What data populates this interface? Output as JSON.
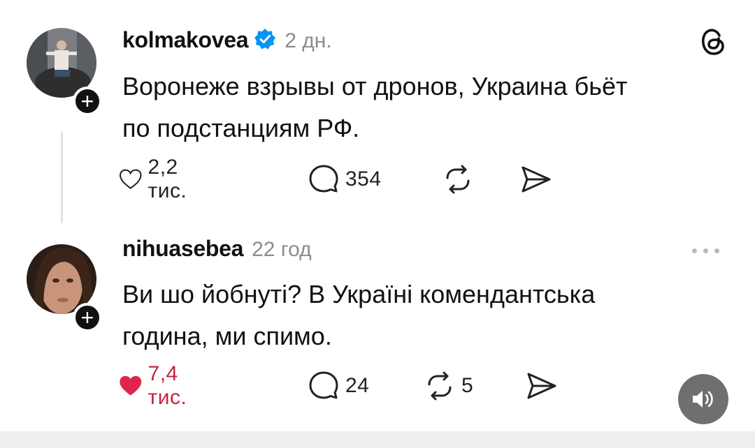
{
  "posts": [
    {
      "username": "kolmakovea",
      "verified": true,
      "time": "2 дн.",
      "text_lines": [
        "Воронеже взрывы от дронов, Украина бьёт",
        "по подстанциям РФ."
      ],
      "likes": "2,2 тис.",
      "liked": false,
      "comments": "354",
      "reposts": "",
      "avatar_icon": "avatar-photo-man-on-bull-statue"
    },
    {
      "username": "nihuasebea",
      "verified": false,
      "time": "22 год",
      "text_lines": [
        "Ви шо йобнуті? В Україні комендантська",
        "година, ми спимо."
      ],
      "likes": "7,4 тис.",
      "liked": true,
      "comments": "24",
      "reposts": "5",
      "avatar_icon": "avatar-photo-woman"
    }
  ],
  "icons": {
    "follow": "+",
    "like": "heart-icon",
    "comment": "comment-bubble-icon",
    "repost": "repost-icon",
    "share": "send-icon",
    "brand": "threads-logo-icon",
    "more": "more-dots-icon",
    "sound": "speaker-icon"
  },
  "colors": {
    "liked": "#e0244a",
    "verified": "#0095f6",
    "muted": "#8c8c8c"
  }
}
